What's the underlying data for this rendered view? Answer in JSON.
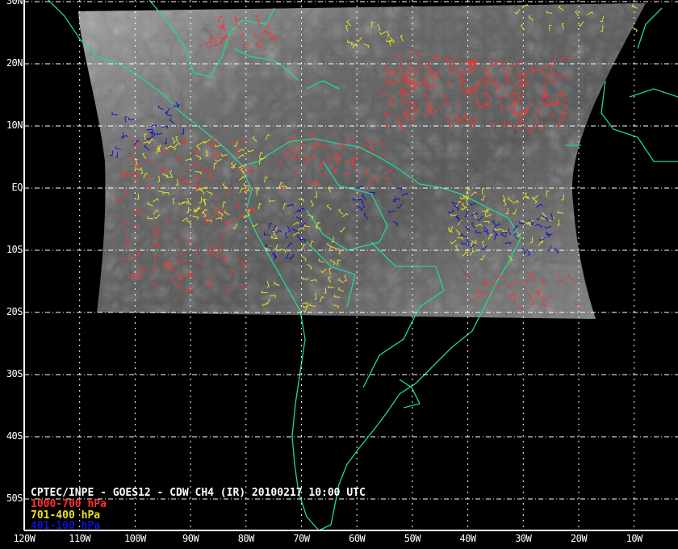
{
  "title": "CPTEC/INPE - GOES12 - CDW CH4 (IR) 20100217 10:00 UTC",
  "legend": [
    {
      "label": "1000-700 hPa",
      "color": "#ff3030"
    },
    {
      "label": "701-400 hPa",
      "color": "#e8e020"
    },
    {
      "label": "401-100 hPa",
      "color": "#1010d0"
    }
  ],
  "lat_labels": [
    "30N",
    "20N",
    "10N",
    "EQ",
    "10S",
    "20S",
    "30S",
    "40S",
    "50S"
  ],
  "lon_labels": [
    "120W",
    "110W",
    "100W",
    "90W",
    "80W",
    "70W",
    "60W",
    "50W",
    "40W",
    "30W",
    "20W",
    "10W"
  ],
  "colors": {
    "coast": "#20d898",
    "grid": "#ffffff",
    "background": "#000000"
  }
}
